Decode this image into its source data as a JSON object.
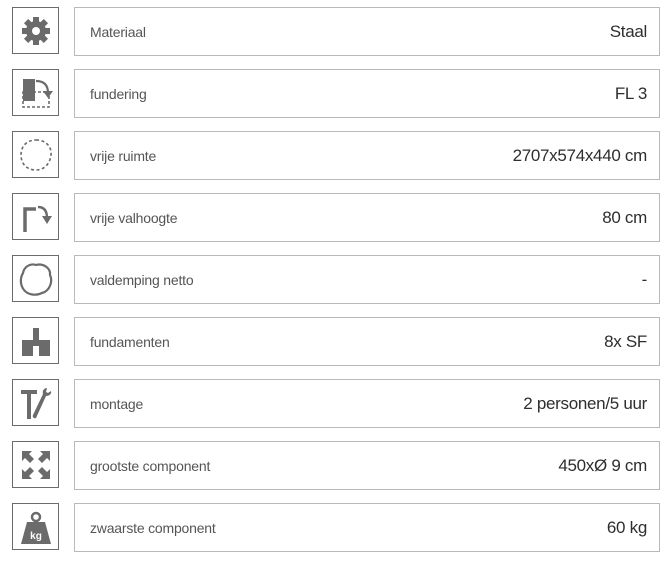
{
  "specs": [
    {
      "icon": "gear-icon",
      "label": "Materiaal",
      "value": "Staal"
    },
    {
      "icon": "foundation-icon",
      "label": "fundering",
      "value": "FL 3"
    },
    {
      "icon": "free-space-icon",
      "label": "vrije ruimte",
      "value": "2707x574x440 cm"
    },
    {
      "icon": "fall-height-icon",
      "label": "vrije valhoogte",
      "value": "80 cm"
    },
    {
      "icon": "impact-damping-icon",
      "label": "valdemping netto",
      "value": "-"
    },
    {
      "icon": "foundations-icon",
      "label": "fundamenten",
      "value": "8x SF"
    },
    {
      "icon": "tools-icon",
      "label": "montage",
      "value": "2 personen/5 uur"
    },
    {
      "icon": "expand-arrows-icon",
      "label": "grootste component",
      "value": "450xØ 9 cm"
    },
    {
      "icon": "weight-icon",
      "label": "zwaarste component",
      "value": "60 kg",
      "icon_text": "kg"
    }
  ],
  "colors": {
    "icon_gray": "#6b6b6b",
    "border": "#b9b9b9",
    "label_text": "#555555",
    "value_text": "#2e2e2e"
  }
}
